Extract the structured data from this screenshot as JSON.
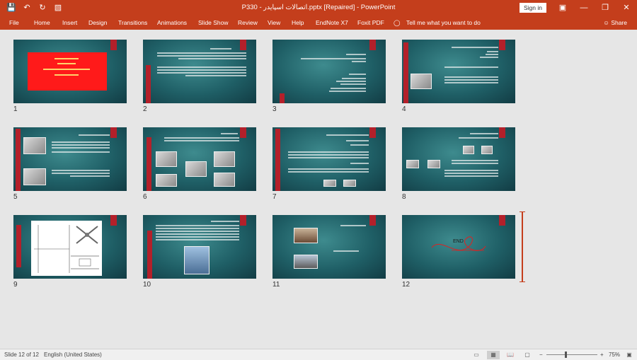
{
  "titlebar": {
    "doc_title": "P330 - اتصالات اسپایدر.pptx [Repaired] - PowerPoint",
    "signin_label": "Sign in",
    "qat": [
      "save-icon",
      "undo-icon",
      "redo-icon",
      "customize-icon"
    ]
  },
  "ribbon": {
    "tabs": [
      "File",
      "Home",
      "Insert",
      "Design",
      "Transitions",
      "Animations",
      "Slide Show",
      "Review",
      "View",
      "Help",
      "EndNote X7",
      "Foxit PDF"
    ],
    "tell_me": "Tell me what you want to do",
    "share_label": "Share"
  },
  "slides": [
    {
      "num": "1"
    },
    {
      "num": "2"
    },
    {
      "num": "3"
    },
    {
      "num": "4"
    },
    {
      "num": "5"
    },
    {
      "num": "6"
    },
    {
      "num": "7"
    },
    {
      "num": "8"
    },
    {
      "num": "9"
    },
    {
      "num": "10"
    },
    {
      "num": "11"
    },
    {
      "num": "12",
      "end_label": "END"
    }
  ],
  "statusbar": {
    "slide_info": "Slide 12 of 12",
    "language": "English (United States)",
    "zoom": "75%",
    "zoom_minus": "−",
    "zoom_plus": "+"
  },
  "colors": {
    "accent": "#c43e1c",
    "slide_bg": "#1f5f66",
    "slide_red": "#b3202a"
  }
}
